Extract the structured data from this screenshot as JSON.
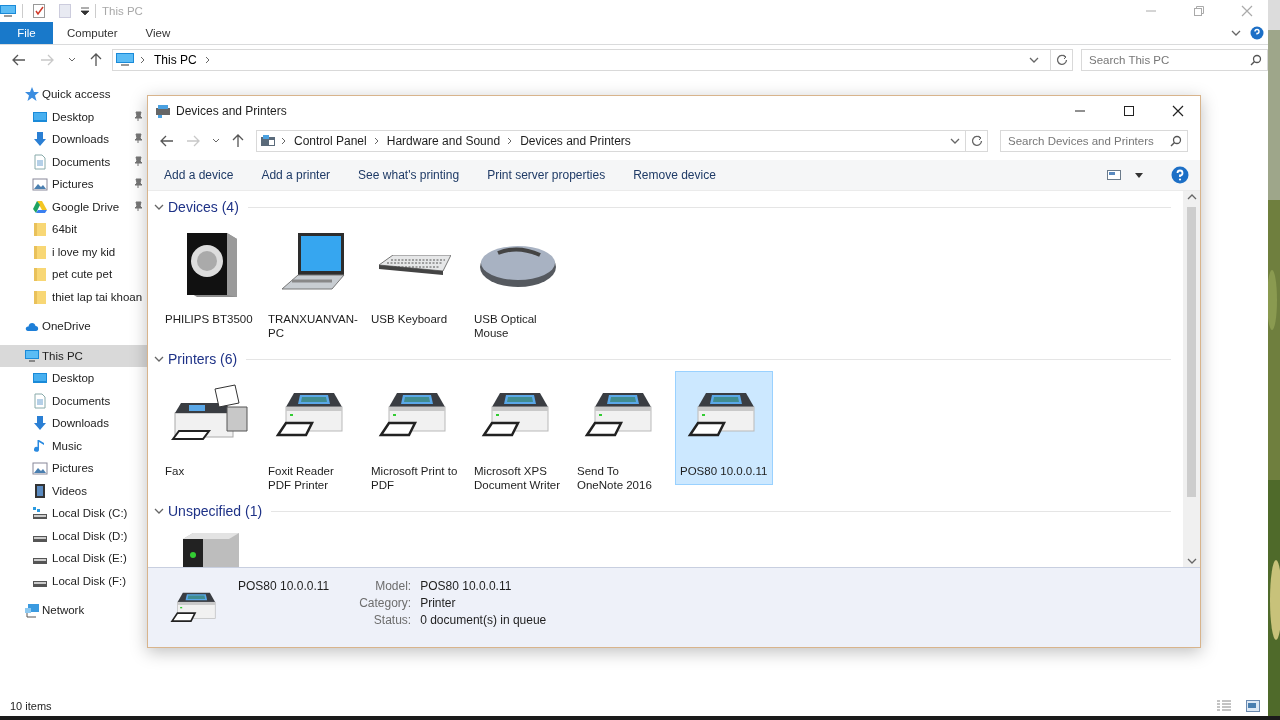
{
  "explorer": {
    "title": "This PC",
    "ribbon_tabs": [
      {
        "label": "File",
        "kind": "file"
      },
      {
        "label": "Computer",
        "kind": "tab"
      },
      {
        "label": "View",
        "kind": "tab"
      }
    ],
    "address": [
      "This PC"
    ],
    "search_placeholder": "Search This PC",
    "nav": [
      {
        "label": "Quick access",
        "kind": "star",
        "selected": false,
        "children": [
          {
            "label": "Desktop",
            "kind": "desktop",
            "pinned": true,
            "selected": false
          },
          {
            "label": "Downloads",
            "kind": "download",
            "pinned": true,
            "selected": false
          },
          {
            "label": "Documents",
            "kind": "document",
            "pinned": true,
            "selected": false
          },
          {
            "label": "Pictures",
            "kind": "pictures",
            "pinned": true,
            "selected": false
          },
          {
            "label": "Google Drive",
            "kind": "drive",
            "pinned": true,
            "selected": false
          },
          {
            "label": "64bit",
            "kind": "folder",
            "pinned": false,
            "selected": false
          },
          {
            "label": "i love my kid",
            "kind": "folder",
            "pinned": false,
            "selected": false
          },
          {
            "label": "pet cute pet",
            "kind": "folder",
            "pinned": false,
            "selected": false
          },
          {
            "label": "thiet lap tai khoan",
            "kind": "folder",
            "pinned": false,
            "selected": false
          }
        ]
      },
      {
        "label": "OneDrive",
        "kind": "cloud",
        "selected": false
      },
      {
        "label": "This PC",
        "kind": "pc",
        "selected": true,
        "children": [
          {
            "label": "Desktop",
            "kind": "desktop",
            "selected": false
          },
          {
            "label": "Documents",
            "kind": "document",
            "selected": false
          },
          {
            "label": "Downloads",
            "kind": "download",
            "selected": false
          },
          {
            "label": "Music",
            "kind": "music",
            "selected": false
          },
          {
            "label": "Pictures",
            "kind": "pictures",
            "selected": false
          },
          {
            "label": "Videos",
            "kind": "video",
            "selected": false
          },
          {
            "label": "Local Disk (C:)",
            "kind": "system-disk",
            "selected": false
          },
          {
            "label": "Local Disk (D:)",
            "kind": "disk",
            "selected": false
          },
          {
            "label": "Local Disk (E:)",
            "kind": "disk",
            "selected": false
          },
          {
            "label": "Local Disk (F:)",
            "kind": "disk",
            "selected": false
          }
        ]
      },
      {
        "label": "Network",
        "kind": "network",
        "selected": false
      }
    ],
    "status": "10 items"
  },
  "devices": {
    "title": "Devices and Printers",
    "breadcrumb": [
      "Control Panel",
      "Hardware and Sound",
      "Devices and Printers"
    ],
    "search_placeholder": "Search Devices and Printers",
    "commands": [
      "Add a device",
      "Add a printer",
      "See what's printing",
      "Print server properties",
      "Remove device"
    ],
    "groups": [
      {
        "title": "Devices (4)",
        "expanded": true,
        "items": [
          {
            "label": "PHILIPS BT3500",
            "kind": "speaker",
            "selected": false
          },
          {
            "label": "TRANXUANVAN-PC",
            "kind": "laptop",
            "selected": false
          },
          {
            "label": "USB Keyboard",
            "kind": "keyboard",
            "selected": false
          },
          {
            "label": "USB Optical Mouse",
            "kind": "mouse",
            "selected": false
          }
        ]
      },
      {
        "title": "Printers (6)",
        "expanded": true,
        "items": [
          {
            "label": "Fax",
            "kind": "fax",
            "selected": false
          },
          {
            "label": "Foxit Reader PDF Printer",
            "kind": "printer",
            "selected": false
          },
          {
            "label": "Microsoft Print to PDF",
            "kind": "printer",
            "selected": false
          },
          {
            "label": "Microsoft XPS Document Writer",
            "kind": "printer",
            "selected": false
          },
          {
            "label": "Send To OneNote 2016",
            "kind": "printer",
            "selected": false
          },
          {
            "label": "POS80 10.0.0.11",
            "kind": "printer",
            "selected": true
          }
        ]
      },
      {
        "title": "Unspecified (1)",
        "expanded": true,
        "items": [
          {
            "kind": "server",
            "selected": false
          }
        ]
      }
    ],
    "details": {
      "name": "POS80 10.0.0.11",
      "kind": "printer",
      "fields": [
        {
          "label": "Model:",
          "value": "POS80 10.0.0.11"
        },
        {
          "label": "Category:",
          "value": "Printer"
        },
        {
          "label": "Status:",
          "value": "0 document(s) in queue"
        }
      ]
    }
  }
}
